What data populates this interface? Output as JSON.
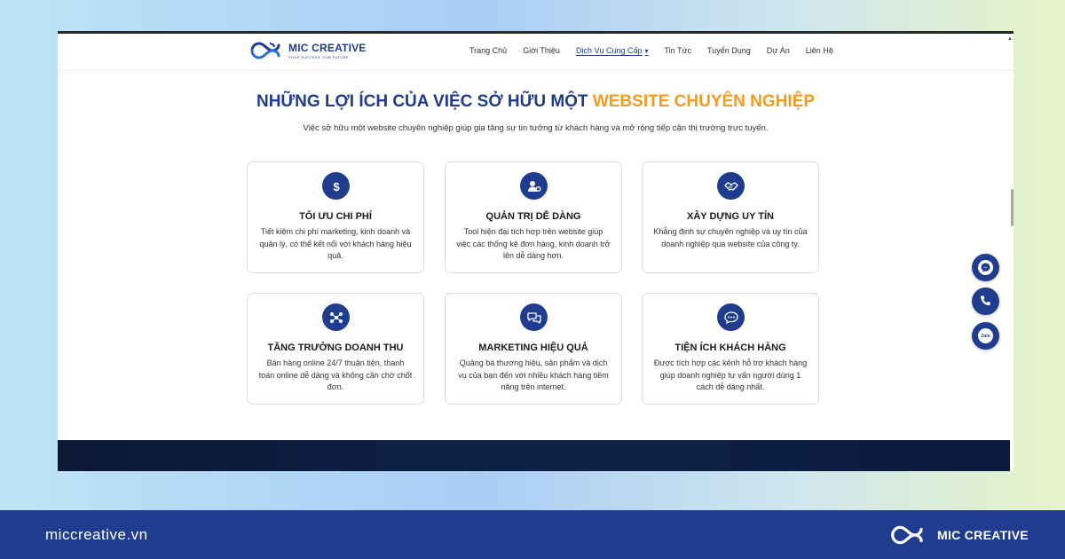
{
  "browser": {
    "logo": {
      "name": "MIC CREATIVE",
      "tagline": "YOUR SUCCESS, OUR FUTURE"
    },
    "nav": [
      {
        "label": "Trang Chủ"
      },
      {
        "label": "Giới Thiệu"
      },
      {
        "label": "Dịch Vụ Cung Cấp",
        "active": true
      },
      {
        "label": "Tin Tức"
      },
      {
        "label": "Tuyển Dụng"
      },
      {
        "label": "Dự Án"
      },
      {
        "label": "Liên Hệ"
      }
    ],
    "heading": {
      "part1": "NHỮNG LỢI ÍCH CỦA VIỆC SỞ HỮU MỘT",
      "part2": "WEBSITE CHUYÊN NGHIỆP"
    },
    "subheading": "Việc sở hữu một website chuyên nghiệp giúp gia tăng sự tin tưởng từ khách hàng và mở rộng tiếp cận thị trường trực tuyến.",
    "cards": [
      {
        "icon": "dollar-icon",
        "title": "TỐI ƯU CHI PHÍ",
        "desc": "Tiết kiệm chi phí marketing, kinh doanh và quản lý, có thể kết nối với khách hàng hiệu quả."
      },
      {
        "icon": "user-settings-icon",
        "title": "QUẢN TRỊ DỄ DÀNG",
        "desc": "Tool hiện đại tích hợp trên website giúp việc các thống kê đơn hàng, kinh doanh trở lên dễ dàng hơn."
      },
      {
        "icon": "handshake-icon",
        "title": "XÂY DỰNG UY TÍN",
        "desc": "Khẳng định sự chuyên nghiệp và uy tín của doanh nghiệp qua website của công ty."
      },
      {
        "icon": "growth-network-icon",
        "title": "TĂNG TRƯỞNG DOANH THU",
        "desc": "Bán hàng online 24/7 thuận tiện, thanh toán online dễ dàng và không cần chờ chốt đơn."
      },
      {
        "icon": "chat-bubbles-icon",
        "title": "MARKETING HIỆU QUẢ",
        "desc": "Quảng bá thương hiệu, sản phẩm và dịch vụ của bạn đến với nhiều khách hàng tiềm năng trên internet."
      },
      {
        "icon": "comment-dots-icon",
        "title": "TIỆN ÍCH KHÁCH HÀNG",
        "desc": "Được tích hợp các kênh hỗ trợ khách hàng giúp doanh nghiệp tư vấn người dùng 1 cách dễ dàng nhất."
      }
    ],
    "floating": [
      {
        "icon": "messenger-icon"
      },
      {
        "icon": "phone-icon"
      },
      {
        "icon": "zalo-icon",
        "label": "Zalo"
      }
    ]
  },
  "footer": {
    "site": "miccreative.vn",
    "brand": "MIC CREATIVE"
  },
  "colors": {
    "primary": "#1f3c8f",
    "accent": "#f29b1e",
    "band": "#0e2247"
  }
}
